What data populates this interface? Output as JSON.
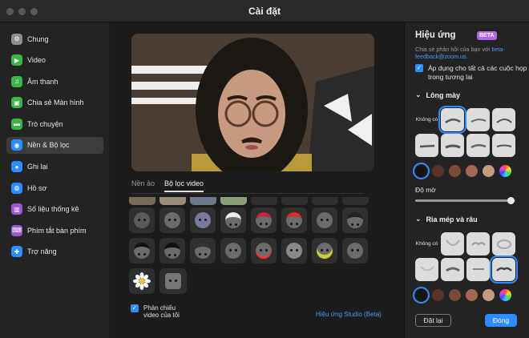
{
  "window": {
    "title": "Cài đặt"
  },
  "sidebar": {
    "items": [
      {
        "label": "Chung",
        "icon": "gear-icon",
        "color": "#8e8e8e"
      },
      {
        "label": "Video",
        "icon": "video-camera-icon",
        "color": "#3bb44a"
      },
      {
        "label": "Âm thanh",
        "icon": "headphones-icon",
        "color": "#3bb44a"
      },
      {
        "label": "Chia sẻ Màn hình",
        "icon": "share-screen-icon",
        "color": "#3bb44a"
      },
      {
        "label": "Trò chuyện",
        "icon": "chat-bubble-icon",
        "color": "#3bb44a"
      },
      {
        "label": "Nền & Bộ lọc",
        "icon": "person-background-icon",
        "color": "#2d8cff",
        "active": true
      },
      {
        "label": "Ghi lại",
        "icon": "record-icon",
        "color": "#2d8cff"
      },
      {
        "label": "Hồ sơ",
        "icon": "profile-icon",
        "color": "#2d8cff"
      },
      {
        "label": "Số liệu thống kê",
        "icon": "statistics-icon",
        "color": "#9b59d0"
      },
      {
        "label": "Phím tắt bàn phím",
        "icon": "keyboard-icon",
        "color": "#9b59d0"
      },
      {
        "label": "Trợ năng",
        "icon": "accessibility-icon",
        "color": "#2d8cff"
      }
    ]
  },
  "center": {
    "tabs": [
      {
        "label": "Nền ảo",
        "active": false
      },
      {
        "label": "Bộ lọc video",
        "active": true
      }
    ],
    "mirror_label_line1": "Phản chiếu",
    "mirror_label_line2": "video của tôi",
    "studio_link": "Hiệu ứng Studio (Beta)"
  },
  "effects": {
    "title": "Hiệu ứng",
    "beta": "BETA",
    "feedback_prefix": "Chia sẻ phản hồi của bạn với ",
    "feedback_link": "beta-feedback@zoom.us",
    "feedback_suffix": ".",
    "apply_label": "Áp dụng cho tất cả các cuộc họp trong tương lai",
    "eyebrows": {
      "title": "Lông mày",
      "none_label": "Không có",
      "swatches": [
        "#151515",
        "#5a3326",
        "#7a4b39",
        "#a36752",
        "#c79a80"
      ],
      "opacity_label": "Độ mờ",
      "opacity_value": 0.96
    },
    "mustache": {
      "title": "Ria mép và râu",
      "none_label": "Không có",
      "swatches": [
        "#151515",
        "#5a3326",
        "#7a4b39",
        "#a36752",
        "#c79a80"
      ]
    },
    "reset_button": "Đặt lại",
    "close_button": "Đóng"
  }
}
